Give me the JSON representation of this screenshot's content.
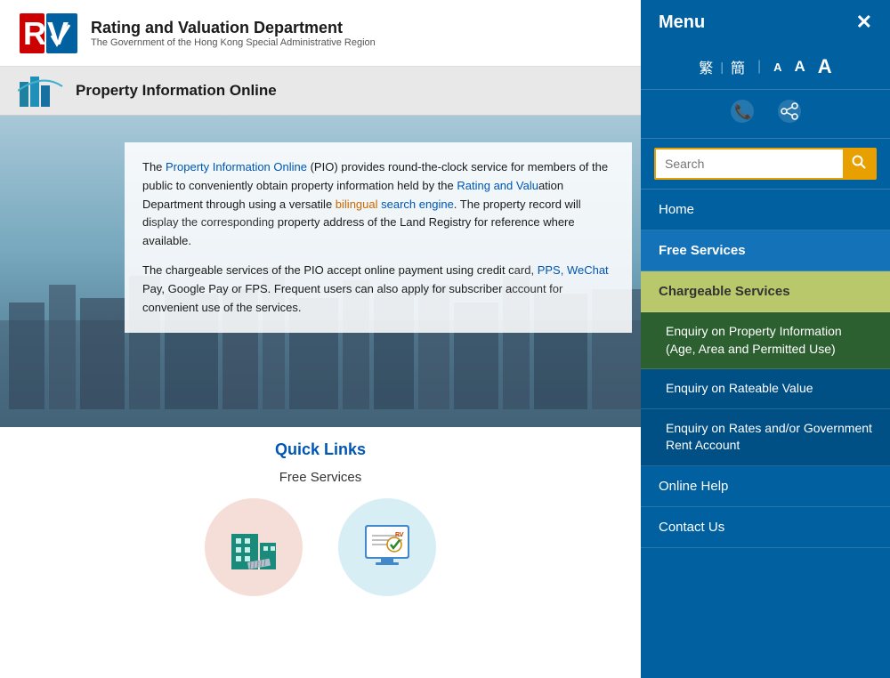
{
  "header": {
    "logo_text": "RV",
    "dept_name": "Rating and Valuation Department",
    "dept_sub": "The Government of the Hong Kong Special Administrative Region",
    "pio_title": "Property Information Online"
  },
  "hero": {
    "para1": "The Property Information Online (PIO) provides round-the-clock service for members of the public to conveniently obtain property information held by the Rating and Valuation Department through using a versatile bilingual search engine.  The property record will display the corresponding property address of the Land Registry for reference where available.",
    "para2": "The chargeable services of the PIO accept online payment using credit card, PPS, WeChat Pay, Google Pay or FPS.  Frequent users can also apply for subscriber account for convenient use of the services."
  },
  "quick_links": {
    "title": "Quick Links",
    "section_title": "Free Services"
  },
  "menu": {
    "title": "Menu",
    "close_label": "✕",
    "lang": {
      "trad": "繁",
      "simp": "簡"
    },
    "font_sizes": [
      "A",
      "A",
      "A"
    ],
    "search_placeholder": "Search",
    "items": {
      "home": "Home",
      "free_services": "Free Services",
      "chargeable_services": "Chargeable Services",
      "submenu_enquiry_property": "Enquiry on Property Information (Age, Area and Permitted Use)",
      "submenu_enquiry_rateable": "Enquiry on Rateable Value",
      "submenu_enquiry_rates": "Enquiry on Rates and/or Government Rent Account",
      "online_help": "Online Help",
      "contact_us": "Contact Us"
    }
  }
}
